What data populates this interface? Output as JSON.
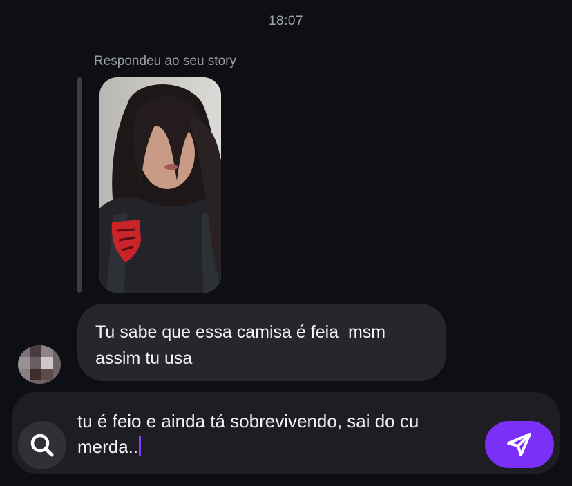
{
  "chat": {
    "timestamp": "18:07",
    "reply_caption": "Respondeu ao seu story",
    "incoming_message": "Tu sabe que essa camisa é feia  msm\nassim tu usa"
  },
  "composer": {
    "draft_line1": "tu é feio e ainda tá sobrevivendo, sai do cu",
    "draft_line2": "merda..",
    "search_icon": "search-icon",
    "send_icon": "send-icon"
  },
  "colors": {
    "background": "#0d0f14",
    "bubble": "#25272d",
    "composer": "#1c1e23",
    "accent": "#7b2ff7",
    "caret": "#8b3dff"
  }
}
